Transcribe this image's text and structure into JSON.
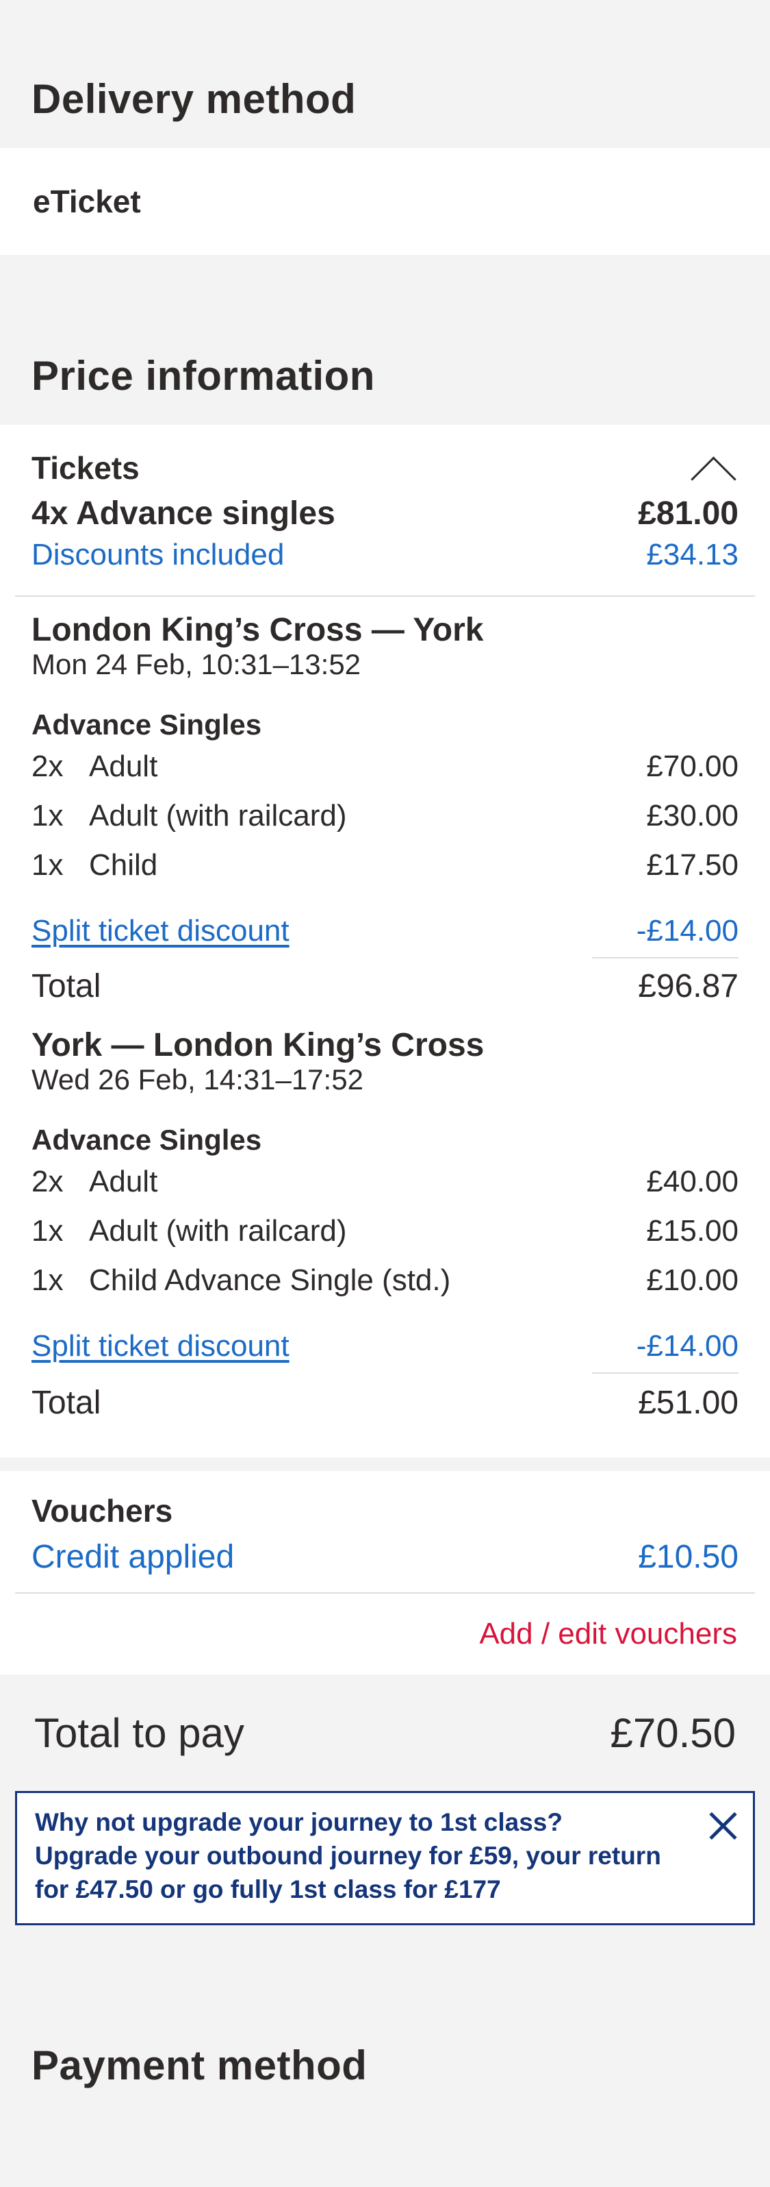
{
  "delivery": {
    "title": "Delivery method",
    "value": "eTicket"
  },
  "price": {
    "title": "Price information",
    "tickets_label": "Tickets",
    "summary": {
      "label": "4x Advance singles",
      "amount": "£81.00",
      "discount_label": "Discounts included",
      "discount_amount": "£34.13"
    },
    "journeys": [
      {
        "route": "London King’s Cross — York",
        "datetime": "Mon 24 Feb, 10:31–13:52",
        "fare_type": "Advance Singles",
        "lines": [
          {
            "qty": "2x",
            "label": "Adult",
            "amount": "£70.00"
          },
          {
            "qty": "1x",
            "label": "Adult (with railcard)",
            "amount": "£30.00"
          },
          {
            "qty": "1x",
            "label": "Child",
            "amount": "£17.50"
          }
        ],
        "split_label": "Split ticket discount",
        "split_amount": "-£14.00",
        "total_label": "Total",
        "total_amount": "£96.87"
      },
      {
        "route": "York — London King’s Cross",
        "datetime": "Wed 26 Feb, 14:31–17:52",
        "fare_type": "Advance Singles",
        "lines": [
          {
            "qty": "2x",
            "label": "Adult",
            "amount": "£40.00"
          },
          {
            "qty": "1x",
            "label": "Adult (with railcard)",
            "amount": "£15.00"
          },
          {
            "qty": "1x",
            "label": "Child Advance Single (std.)",
            "amount": "£10.00"
          }
        ],
        "split_label": "Split ticket discount",
        "split_amount": "-£14.00",
        "total_label": "Total",
        "total_amount": "£51.00"
      }
    ]
  },
  "vouchers": {
    "title": "Vouchers",
    "credit_label": "Credit applied",
    "credit_amount": "£10.50",
    "add_edit_label": "Add / edit vouchers"
  },
  "total_to_pay": {
    "label": "Total to pay",
    "amount": "£70.50"
  },
  "upgrade_banner": {
    "text": "Why not upgrade your journey to 1st class? Upgrade your outbound journey for £59, your return for £47.50 or go fully 1st class for £177"
  },
  "payment": {
    "title": "Payment method"
  },
  "colors": {
    "link_blue": "#1c6bc6",
    "voucher_red": "#d9143b",
    "banner_navy": "#15357a",
    "text_dark": "#2e2a2a",
    "page_gray": "#f3f3f3"
  },
  "icons": {
    "tickets_toggle": "chevron-up-icon",
    "banner_close": "close-icon"
  }
}
